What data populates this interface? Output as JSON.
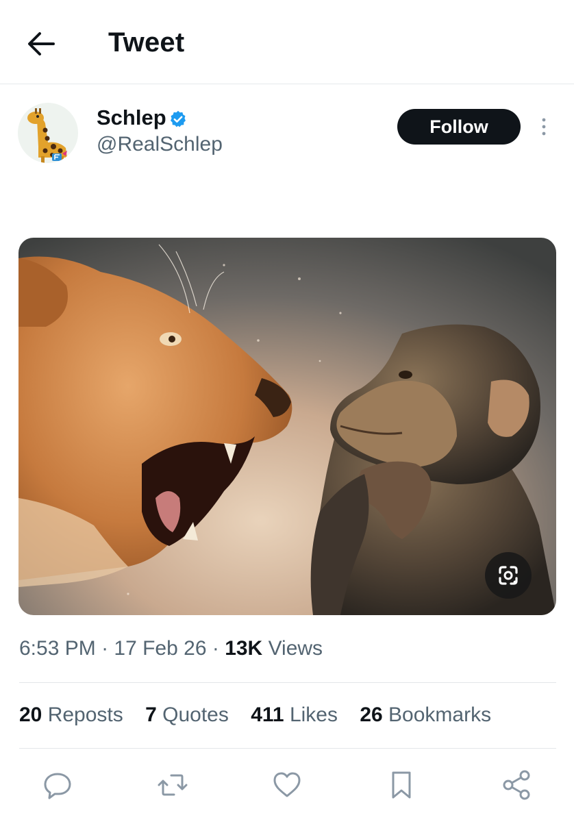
{
  "header": {
    "title": "Tweet"
  },
  "author": {
    "display_name": "Schlep",
    "handle": "@RealSchlep",
    "verified_icon": "verified-badge-icon",
    "avatar": "giraffe-avatar"
  },
  "follow": {
    "label": "Follow"
  },
  "media": {
    "description_icon": "lens-search-icon"
  },
  "meta": {
    "time": "6:53 PM",
    "sep1": " · ",
    "date": "17 Feb 26",
    "sep2": " · ",
    "views_count": "13K",
    "views_label": " Views"
  },
  "stats": [
    {
      "count": "20",
      "label": " Reposts"
    },
    {
      "count": "7",
      "label": " Quotes"
    },
    {
      "count": "411",
      "label": " Likes"
    },
    {
      "count": "26",
      "label": " Bookmarks"
    }
  ],
  "actions": [
    "reply-icon",
    "repost-icon",
    "like-icon",
    "bookmark-icon",
    "share-icon"
  ],
  "colors": {
    "text_primary": "#0f1419",
    "text_secondary": "#536471",
    "verified_blue": "#1d9bf0",
    "follow_bg": "#0f1419"
  }
}
